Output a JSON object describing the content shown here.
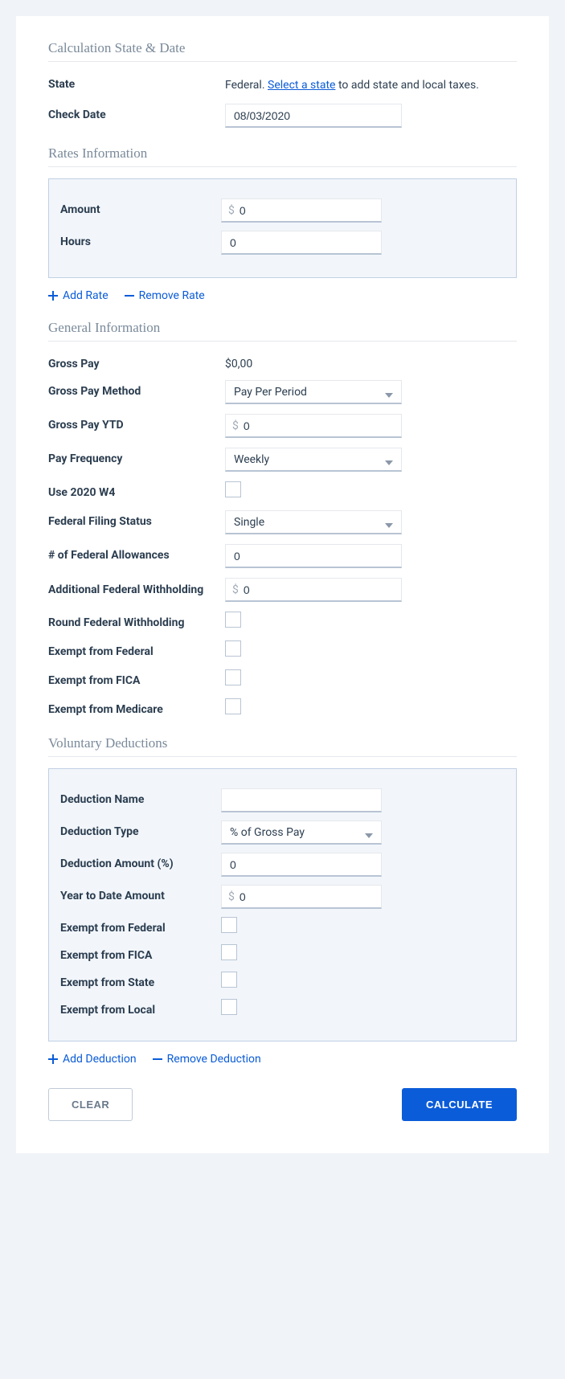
{
  "sections": {
    "state_date": "Calculation State & Date",
    "rates": "Rates Information",
    "general": "General Information",
    "deductions": "Voluntary Deductions"
  },
  "state_date": {
    "state_label": "State",
    "state_prefix": "Federal. ",
    "state_link": "Select a state",
    "state_suffix": " to add state and local taxes.",
    "check_date_label": "Check Date",
    "check_date_value": "08/03/2020"
  },
  "rates": {
    "amount_label": "Amount",
    "amount_value": "0",
    "hours_label": "Hours",
    "hours_value": "0",
    "add_label": "Add Rate",
    "remove_label": "Remove Rate"
  },
  "general": {
    "gross_pay_label": "Gross Pay",
    "gross_pay_value": "$0,00",
    "gross_pay_method_label": "Gross Pay Method",
    "gross_pay_method_value": "Pay Per Period",
    "gross_pay_ytd_label": "Gross Pay YTD",
    "gross_pay_ytd_value": "0",
    "pay_frequency_label": "Pay Frequency",
    "pay_frequency_value": "Weekly",
    "use_2020_w4_label": "Use 2020 W4",
    "filing_status_label": "Federal Filing Status",
    "filing_status_value": "Single",
    "allowances_label": "# of Federal Allowances",
    "allowances_value": "0",
    "additional_wh_label": "Additional Federal Withholding",
    "additional_wh_value": "0",
    "round_wh_label": "Round Federal Withholding",
    "exempt_federal_label": "Exempt from Federal",
    "exempt_fica_label": "Exempt from FICA",
    "exempt_medicare_label": "Exempt from Medicare"
  },
  "deductions": {
    "name_label": "Deduction Name",
    "name_value": "",
    "type_label": "Deduction Type",
    "type_value": "% of Gross Pay",
    "amount_label": "Deduction Amount (%)",
    "amount_value": "0",
    "ytd_label": "Year to Date Amount",
    "ytd_value": "0",
    "exempt_federal_label": "Exempt from Federal",
    "exempt_fica_label": "Exempt from FICA",
    "exempt_state_label": "Exempt from State",
    "exempt_local_label": "Exempt from Local",
    "add_label": "Add Deduction",
    "remove_label": "Remove Deduction"
  },
  "buttons": {
    "clear": "CLEAR",
    "calculate": "CALCULATE"
  },
  "currency_symbol": "$"
}
